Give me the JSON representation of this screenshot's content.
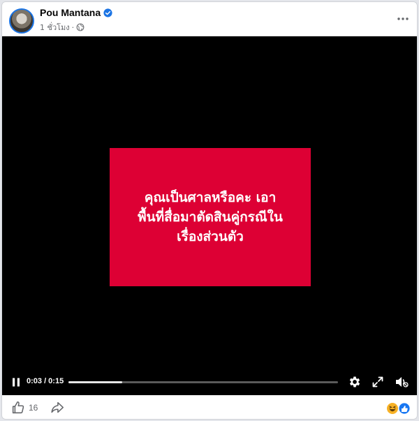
{
  "post": {
    "author": "Pou Mantana",
    "timestamp": "1 ชั่วโมง",
    "separator": "·",
    "audience_icon": "globe-icon"
  },
  "video": {
    "overlay_text": "คุณเป็นศาลหรือคะ เอา\nพื้นที่สื่อมาตัดสินคู่กรณีใน\nเรื่องส่วนตัว",
    "time_display": "0:03 / 0:15",
    "progress": 0.2,
    "card_color": "#dd0034",
    "state": "playing"
  },
  "footer": {
    "like_count": "16",
    "reactions": [
      "haha-icon",
      "like-reaction-icon"
    ]
  },
  "colors": {
    "verified": "#1b74e4",
    "muted_text": "#65676b"
  }
}
